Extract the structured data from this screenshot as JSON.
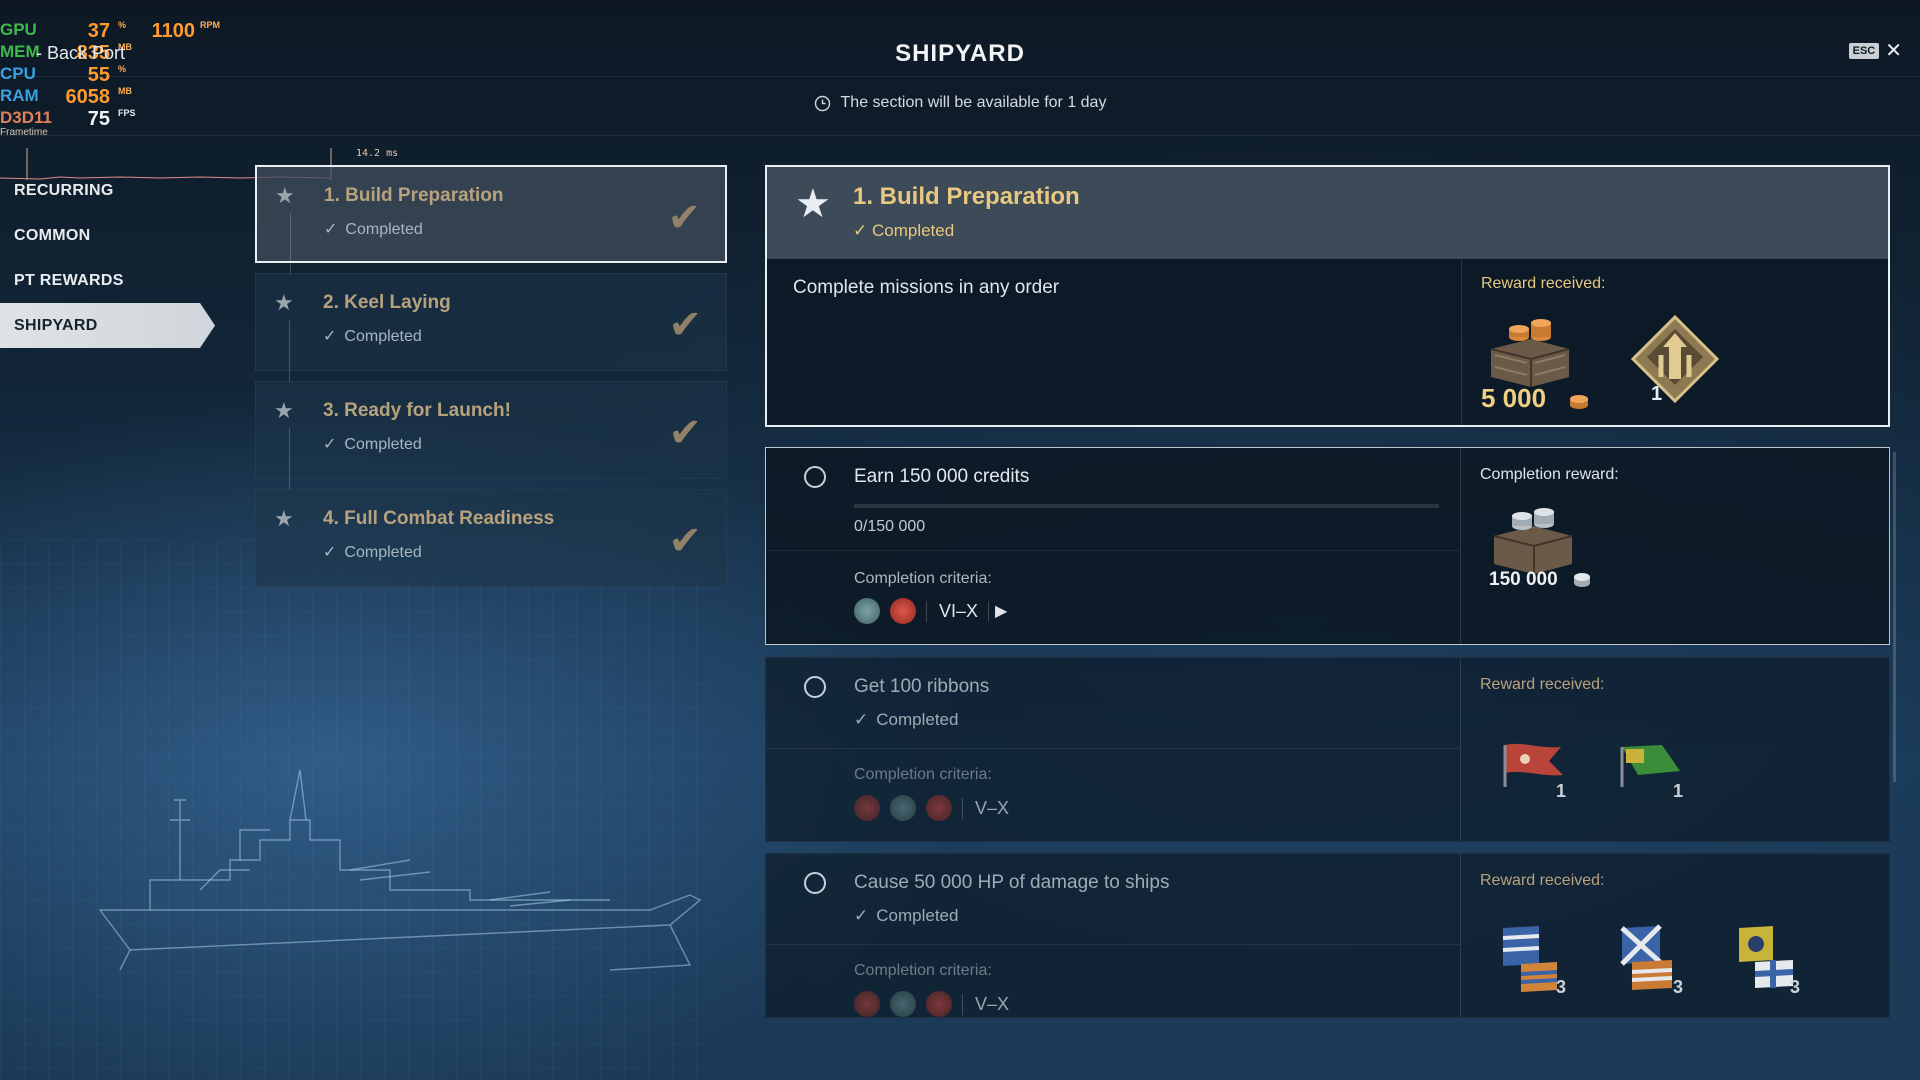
{
  "header": {
    "title": "SHIPYARD",
    "availability": "The section will be available for 1 day",
    "esc_label": "ESC",
    "close_symbol": "✕"
  },
  "perf_overlay": {
    "gpu": {
      "label": "GPU",
      "value": "37",
      "unit": "%"
    },
    "rpm": {
      "value": "1100",
      "unit": "RPM"
    },
    "mem": {
      "label": "MEM",
      "value": "835",
      "unit": "MB"
    },
    "cpu": {
      "label": "CPU",
      "value": "55",
      "unit": "%"
    },
    "ram": {
      "label": "RAM",
      "value": "6058",
      "unit": "MB"
    },
    "api": {
      "label": "D3D11",
      "value": "75",
      "unit": "FPS"
    },
    "frametime_label": "Frametime",
    "frametime_value": "14.2 ms",
    "overlap_text": "- Back Port",
    "colors": {
      "gpu": "#3fb84a",
      "mem": "#3fb84a",
      "cpu": "#3aa0e0",
      "ram": "#3aa0e0",
      "api": "#e0805a"
    }
  },
  "nav": {
    "items": [
      {
        "label": "RECURRING"
      },
      {
        "label": "COMMON"
      },
      {
        "label": "PT REWARDS"
      },
      {
        "label": "SHIPYARD",
        "active": true
      }
    ]
  },
  "stages": [
    {
      "title": "1. Build Preparation",
      "status": "Completed",
      "selected": true
    },
    {
      "title": "2. Keel Laying",
      "status": "Completed"
    },
    {
      "title": "3. Ready for Launch!",
      "status": "Completed"
    },
    {
      "title": "4. Full Combat Readiness",
      "status": "Completed"
    }
  ],
  "detail": {
    "title": "1. Build Preparation",
    "status": "Completed",
    "description": "Complete missions in any order",
    "reward_label": "Reward received:",
    "rewards": [
      {
        "icon": "doubloon-crate-icon",
        "count": "5 000"
      },
      {
        "icon": "tier-badge-icon",
        "count": "1"
      }
    ]
  },
  "missions": [
    {
      "title": "Earn 150 000 credits",
      "progress": "0/150 000",
      "progress_fraction": 0,
      "criteria_label": "Completion criteria:",
      "tier": "VI–X",
      "reward_label": "Completion reward:",
      "reward_count": "150 000",
      "reward_icon": "credits-crate-icon"
    },
    {
      "title": "Get 100 ribbons",
      "status": "Completed",
      "criteria_label": "Completion criteria:",
      "tier": "V–X",
      "reward_label": "Reward received:",
      "flags": [
        {
          "icon": "red-flag-icon",
          "count": "1"
        },
        {
          "icon": "green-flag-icon",
          "count": "1"
        }
      ]
    },
    {
      "title": "Cause 50 000 HP of damage to ships",
      "status": "Completed",
      "criteria_label": "Completion criteria:",
      "tier": "V–X",
      "reward_label": "Reward received:",
      "flags": [
        {
          "icon": "signal-flag-blue-icon",
          "count": "3"
        },
        {
          "icon": "signal-flag-cross-icon",
          "count": "3"
        },
        {
          "icon": "signal-flag-yellow-icon",
          "count": "3"
        }
      ]
    }
  ],
  "colors": {
    "accent_gold": "#e8c780",
    "active_nav": "#dfe3e7"
  }
}
